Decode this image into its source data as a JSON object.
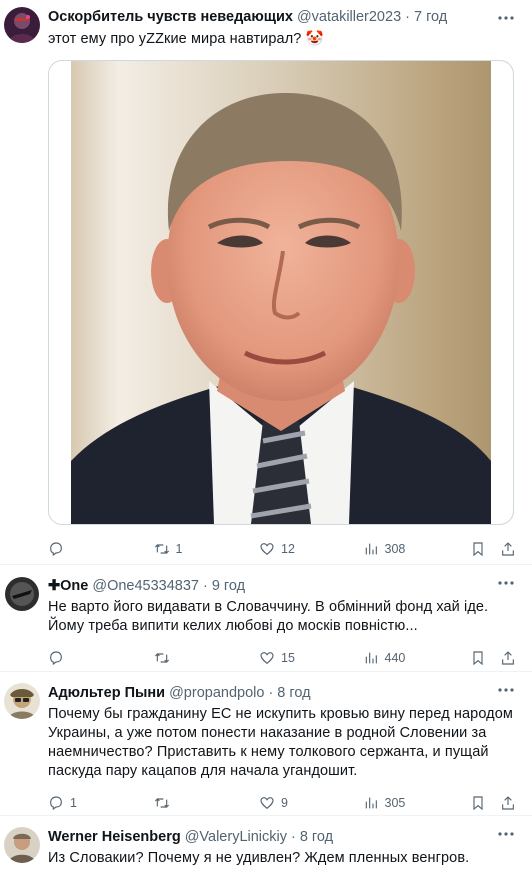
{
  "tweets": [
    {
      "name": "Оскорбитель чувств неведающих",
      "handle": "@vatakiller2023",
      "sep": "·",
      "time": "7 год",
      "text": "этот ему про уZZкие мира навтирал? 🤡",
      "has_media": true,
      "replies": "",
      "retweets": "1",
      "likes": "12",
      "views": "308"
    },
    {
      "name": "✚One",
      "handle": "@One45334837",
      "sep": "·",
      "time": "9 год",
      "text": "Не варто його видавати в Словаччину. В обмінний фонд хай іде. Йому треба випити келих любові до москів повністю...",
      "has_media": false,
      "replies": "",
      "retweets": "",
      "likes": "15",
      "views": "440"
    },
    {
      "name": "Адюльтер Пыни",
      "handle": "@propandpolo",
      "sep": "·",
      "time": "8 год",
      "text": "Почему бы гражданину ЕС не искупить кровью вину перед народом Украины, а уже потом понести наказание в родной Словении за наемничество? Приставить к нему толкового сержанта, и пущай паскуда пару кацапов для начала угандошит.",
      "has_media": false,
      "replies": "1",
      "retweets": "",
      "likes": "9",
      "views": "305"
    },
    {
      "name": "Werner Heisenberg",
      "handle": "@ValeryLinickiy",
      "sep": "·",
      "time": "8 год",
      "text": "Из Словакии? Почему я не удивлен? Ждем пленных венгров.",
      "has_media": false
    }
  ],
  "icons": {
    "reply": "reply-icon",
    "retweet": "retweet-icon",
    "like": "like-icon",
    "views": "views-icon",
    "bookmark": "bookmark-icon",
    "share": "share-icon",
    "more": "more-icon"
  }
}
